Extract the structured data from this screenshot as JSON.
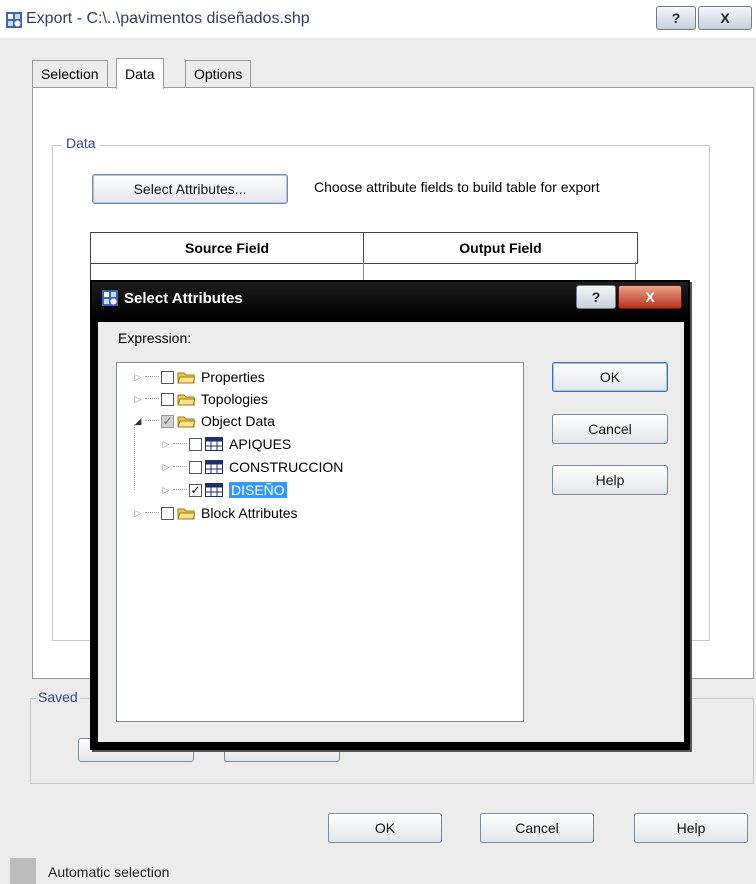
{
  "main_window": {
    "title": "Export - C:\\..\\pavimentos diseñados.shp",
    "help_glyph": "?",
    "close_glyph": "X",
    "tabs": [
      {
        "label": "Selection"
      },
      {
        "label": "Data"
      },
      {
        "label": "Options"
      }
    ],
    "data_group": {
      "label": "Data",
      "select_attributes_button": "Select Attributes...",
      "select_attributes_description": "Choose attribute fields to build table for export",
      "table_headers": [
        "Source Field",
        "Output Field"
      ]
    },
    "saved_group_label": "Saved",
    "buttons": {
      "ok": "OK",
      "cancel": "Cancel",
      "help": "Help"
    },
    "status_text": "Automatic selection"
  },
  "dialog": {
    "title": "Select Attributes",
    "help_glyph": "?",
    "close_glyph": "X",
    "expression_label": "Expression:",
    "tree": [
      {
        "label": "Properties",
        "checked": "unchecked",
        "icon": "folder-icon"
      },
      {
        "label": "Topologies",
        "checked": "unchecked",
        "icon": "folder-icon"
      },
      {
        "label": "Object Data",
        "checked": "partial",
        "icon": "folder-icon",
        "expanded": true
      },
      {
        "label": "APIQUES",
        "checked": "unchecked",
        "icon": "table-icon"
      },
      {
        "label": "CONSTRUCCION",
        "checked": "unchecked",
        "icon": "table-icon"
      },
      {
        "label": "DISEÑO",
        "checked": "checked",
        "icon": "table-icon",
        "selected": true
      },
      {
        "label": "Block Attributes",
        "checked": "unchecked",
        "icon": "folder-icon"
      }
    ],
    "buttons": {
      "ok": "OK",
      "cancel": "Cancel",
      "help": "Help"
    }
  },
  "colors": {
    "selection_highlight": "#3399ff",
    "title_text": "#2f3d66",
    "group_label": "#2d4a8a",
    "dialog_titlebar": "#000000"
  }
}
